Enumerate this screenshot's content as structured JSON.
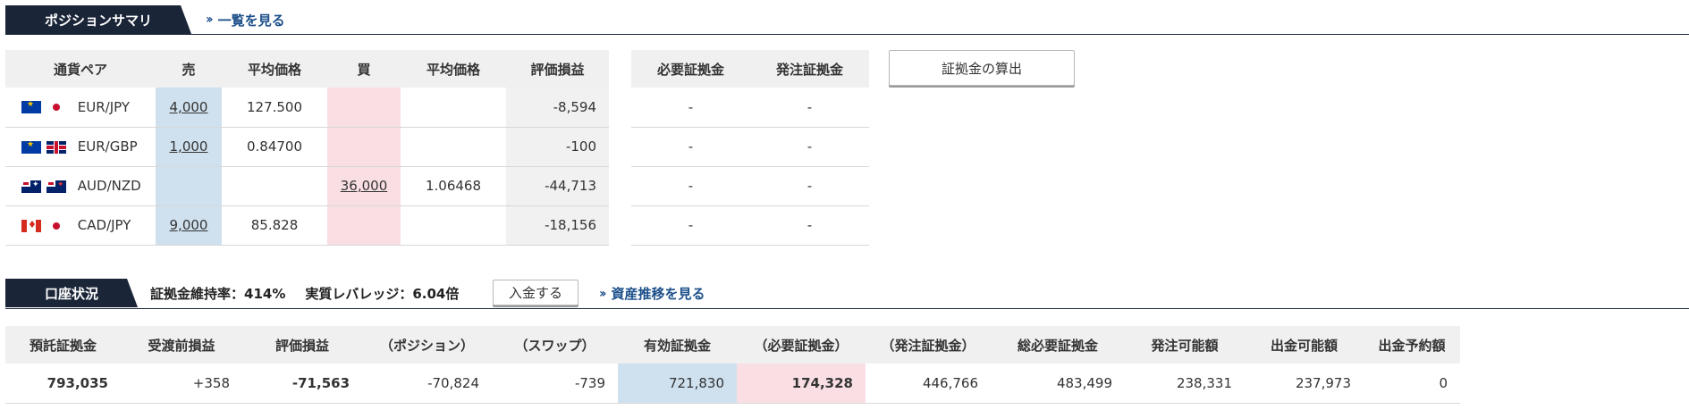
{
  "position_summary": {
    "title": "ポジションサマリ",
    "view_list_link": "一覧を見る",
    "columns": [
      "通貨ペア",
      "売",
      "平均価格",
      "買",
      "平均価格",
      "評価損益"
    ],
    "rows": [
      {
        "pair": "EUR/JPY",
        "flags": [
          "eu-flag-icon",
          "jp-flag-icon"
        ],
        "sell": "4,000",
        "sell_avg": "127.500",
        "buy": "",
        "buy_avg": "",
        "pl": "-8,594"
      },
      {
        "pair": "EUR/GBP",
        "flags": [
          "eu-flag-icon",
          "gb-flag-icon"
        ],
        "sell": "1,000",
        "sell_avg": "0.84700",
        "buy": "",
        "buy_avg": "",
        "pl": "-100"
      },
      {
        "pair": "AUD/NZD",
        "flags": [
          "au-flag-icon",
          "nz-flag-icon"
        ],
        "sell": "",
        "sell_avg": "",
        "buy": "36,000",
        "buy_avg": "1.06468",
        "pl": "-44,713"
      },
      {
        "pair": "CAD/JPY",
        "flags": [
          "ca-flag-icon",
          "jp-flag-icon"
        ],
        "sell": "9,000",
        "sell_avg": "85.828",
        "buy": "",
        "buy_avg": "",
        "pl": "-18,156"
      }
    ],
    "margin_columns": [
      "必要証拠金",
      "発注証拠金"
    ],
    "margin_rows": [
      [
        "-",
        "-"
      ],
      [
        "-",
        "-"
      ],
      [
        "-",
        "-"
      ],
      [
        "-",
        "-"
      ]
    ],
    "calc_button": "証拠金の算出"
  },
  "account_status": {
    "title": "口座状況",
    "margin_rate": "証拠金維持率：414%",
    "leverage": "実質レバレッジ：6.04倍",
    "deposit_button": "入金する",
    "asset_link": "資産推移を見る",
    "columns": [
      "預託証拠金",
      "受渡前損益",
      "評価損益",
      "（ポジション）",
      "（スワップ）",
      "有効証拠金",
      "（必要証拠金）",
      "（発注証拠金）",
      "総必要証拠金",
      "発注可能額",
      "出金可能額",
      "出金予約額"
    ],
    "values": [
      "793,035",
      "+358",
      "-71,563",
      "-70,824",
      "-739",
      "721,830",
      "174,328",
      "446,766",
      "483,499",
      "238,331",
      "237,973",
      "0"
    ]
  },
  "colors": {
    "header_bg": "#1b2538",
    "link": "#1c4f8a",
    "sell_bg": "#cfe1ef",
    "buy_bg": "#f9dfe3"
  }
}
